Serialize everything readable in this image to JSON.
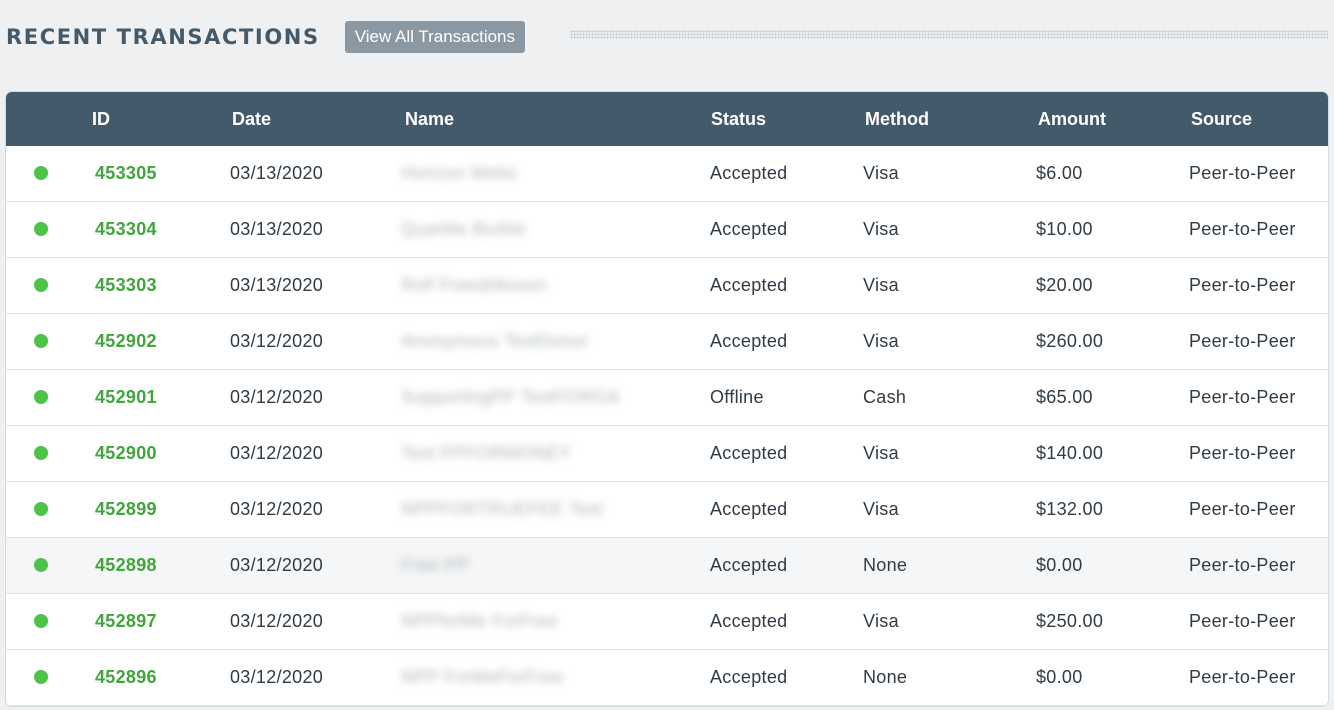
{
  "header": {
    "title": "RECENT TRANSACTIONS",
    "view_all_label": "View All Transactions"
  },
  "table": {
    "columns": [
      "ID",
      "Date",
      "Name",
      "Status",
      "Method",
      "Amount",
      "Source"
    ],
    "rows": [
      {
        "id": "453305",
        "date": "03/13/2020",
        "name": "Horizon Webs",
        "status": "Accepted",
        "method": "Visa",
        "amount": "$6.00",
        "source": "Peer-to-Peer"
      },
      {
        "id": "453304",
        "date": "03/13/2020",
        "name": "Quarble Burble",
        "status": "Accepted",
        "method": "Visa",
        "amount": "$10.00",
        "source": "Peer-to-Peer"
      },
      {
        "id": "453303",
        "date": "03/13/2020",
        "name": "Rolf Freedriksson",
        "status": "Accepted",
        "method": "Visa",
        "amount": "$20.00",
        "source": "Peer-to-Peer"
      },
      {
        "id": "452902",
        "date": "03/12/2020",
        "name": "Anonymous TestDonor",
        "status": "Accepted",
        "method": "Visa",
        "amount": "$260.00",
        "source": "Peer-to-Peer"
      },
      {
        "id": "452901",
        "date": "03/12/2020",
        "name": "SupportingPP TestFORGA",
        "status": "Offline",
        "method": "Cash",
        "amount": "$65.00",
        "source": "Peer-to-Peer"
      },
      {
        "id": "452900",
        "date": "03/12/2020",
        "name": "Test PPFORMONEY",
        "status": "Accepted",
        "method": "Visa",
        "amount": "$140.00",
        "source": "Peer-to-Peer"
      },
      {
        "id": "452899",
        "date": "03/12/2020",
        "name": "NPPFORTRUEFEE Test",
        "status": "Accepted",
        "method": "Visa",
        "amount": "$132.00",
        "source": "Peer-to-Peer"
      },
      {
        "id": "452898",
        "date": "03/12/2020",
        "name": "Free PP",
        "status": "Accepted",
        "method": "None",
        "amount": "$0.00",
        "source": "Peer-to-Peer"
      },
      {
        "id": "452897",
        "date": "03/12/2020",
        "name": "NPPforMe ForFree",
        "status": "Accepted",
        "method": "Visa",
        "amount": "$250.00",
        "source": "Peer-to-Peer"
      },
      {
        "id": "452896",
        "date": "03/12/2020",
        "name": "NPP ForMeForFree",
        "status": "Accepted",
        "method": "None",
        "amount": "$0.00",
        "source": "Peer-to-Peer"
      }
    ]
  },
  "colors": {
    "header_bg": "#435a6b",
    "status_accepted": "#4ec24b",
    "id_link": "#3fa639",
    "button_bg": "#8a98a3"
  }
}
